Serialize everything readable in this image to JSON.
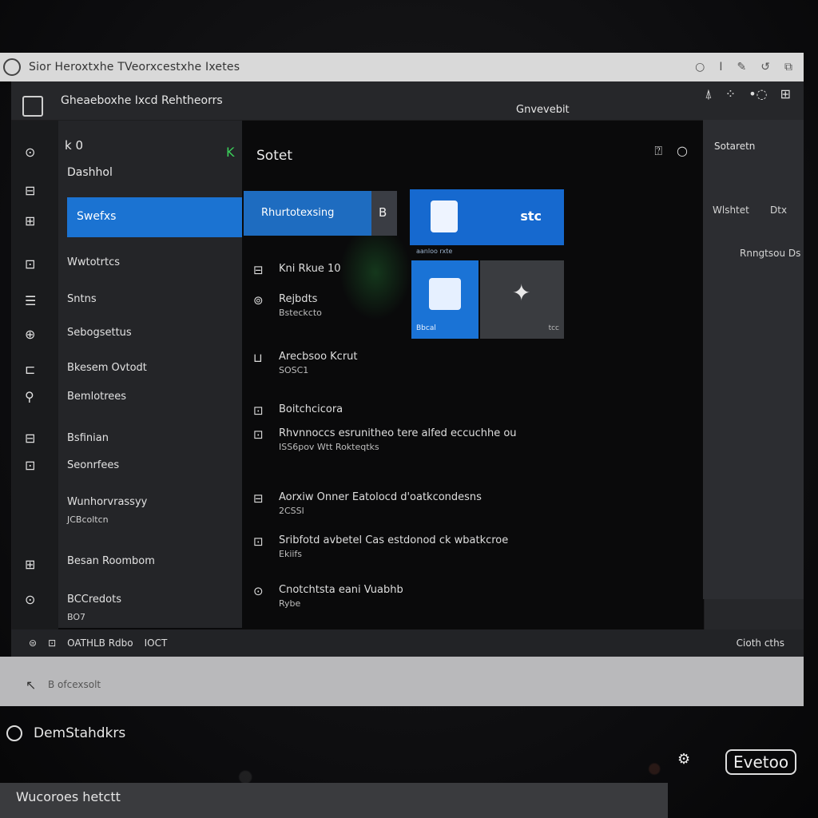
{
  "window": {
    "title": "Sior Heroxtxhe TVeorxcestxhe Ixetes"
  },
  "titlebar_controls": [
    "○",
    "I",
    "✎",
    "↺",
    "⧉"
  ],
  "app": {
    "name": "Gheaeboxhe Ixcd Rehtheorrs",
    "account": "Gnvevebit",
    "header_icons": [
      "⍋",
      "⁘",
      "•◌",
      "⊞"
    ]
  },
  "rail_icons": [
    "⊙",
    "⊟",
    "⊞",
    "⊡",
    "☰",
    "⊕",
    "⊏",
    "⚲",
    "⊟",
    "⊡",
    "⊞",
    "⊙"
  ],
  "nav": {
    "top_left": "k 0",
    "header": "Dashhol",
    "selected": "Swefxs",
    "items": [
      {
        "label": "Wwtotrtcs"
      },
      {
        "label": "Sntns"
      },
      {
        "label": "Sebogsettus"
      },
      {
        "label": "Bkesem Ovtodt"
      },
      {
        "label": "Bemlotrees"
      },
      {
        "label": "Bsfinian"
      },
      {
        "label": "Seonrfees"
      },
      {
        "label": "Wunhorvrassyy",
        "sub": "JCBcoltcn"
      },
      {
        "label": "Besan Roombom"
      },
      {
        "label": "BCCredots",
        "sub": "BO7"
      }
    ]
  },
  "center": {
    "tab_marker": "K",
    "title": "Sotet",
    "controls": [
      "⍰",
      "○"
    ],
    "blue_button": "Rhurtotexsing",
    "side_button": "B",
    "tiles": [
      {
        "label": "stc",
        "sub": "aanloo rxte"
      },
      {
        "label": "",
        "sub": "Bbcal"
      },
      {
        "label": "",
        "sub": "tcc"
      }
    ],
    "entries": [
      {
        "icon": "⊟",
        "title": "Kni Rkue 10",
        "sub": ""
      },
      {
        "icon": "⊚",
        "title": "Rejbdts",
        "sub": "Bsteckcto"
      },
      {
        "icon": "⊔",
        "title": "Arecbsoo Kcrut",
        "sub": "SOSC1"
      },
      {
        "icon": "⊡",
        "title": "Boitchcicora",
        "sub": ""
      },
      {
        "icon": "⊡",
        "title": "Rhvnnoccs esrunitheo tere alfed eccuchhe ou",
        "sub": "ISS6pov Wtt Rokteqtks"
      },
      {
        "icon": "⊟",
        "title": "Aorxiw Onner Eatolocd d'oatkcondesns",
        "sub": "2CSSl"
      },
      {
        "icon": "⊡",
        "title": "Sribfotd avbetel Cas estdonod ck wbatkcroe",
        "sub": "Ekiifs"
      },
      {
        "icon": "⊙",
        "title": "Cnotchtsta eani Vuabhb",
        "sub": "Rybe"
      }
    ]
  },
  "right_panel": {
    "title": "Sotaretn",
    "items": [
      "Wlshtet",
      "Dtx",
      "Rnngtsou Ds"
    ]
  },
  "statusbar": {
    "left": [
      "⊜",
      "⊡",
      "OATHLB Rdbo",
      "IOCT"
    ],
    "right": "Cioth cths"
  },
  "lowerbar": {
    "back": "↖",
    "crumb": "B ofcexsolt"
  },
  "bottom": {
    "title": "DemStahdkrs",
    "search": "Wucoroes hetctt",
    "badge": "Evetoo",
    "icon": "⚙"
  }
}
